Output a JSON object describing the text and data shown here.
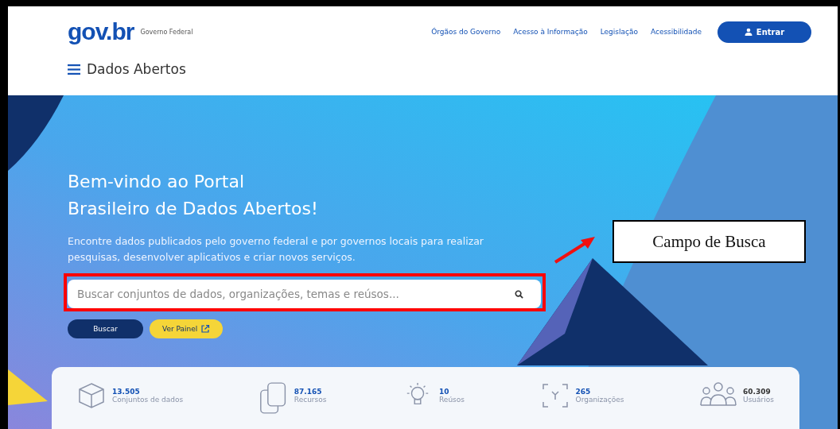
{
  "header": {
    "logo": {
      "wordmark": "gov.br",
      "subtitle": "Governo Federal"
    },
    "nav_links": [
      "Órgãos do Governo",
      "Acesso à Informação",
      "Legislação",
      "Acessibilidade"
    ],
    "login_button": "Entrar",
    "menu_title": "Dados Abertos"
  },
  "hero": {
    "title_lines": [
      "Bem-vindo ao Portal",
      "Brasileiro de Dados Abertos!"
    ],
    "description": "Encontre dados publicados pelo governo federal e por governos locais para realizar pesquisas, desenvolver aplicativos e criar novos serviços.",
    "search": {
      "placeholder": "Buscar conjuntos de dados, organizações, temas e reúsos..."
    },
    "buttons": [
      {
        "label": "Buscar",
        "kind": "primary"
      },
      {
        "label": "Ver Painel",
        "kind": "external"
      }
    ]
  },
  "stats": [
    {
      "value": "13.505",
      "label": "Conjuntos de dados",
      "kind": "cube"
    },
    {
      "value": "87.165",
      "label": "Recursos",
      "kind": "copies"
    },
    {
      "value": "10",
      "label": "Reúsos",
      "kind": "bulb"
    },
    {
      "value": "265",
      "label": "Organizações",
      "kind": "scan"
    },
    {
      "value": "60.309",
      "label": "Usuários",
      "kind": "people"
    }
  ],
  "annotation": {
    "label": "Campo de Busca"
  }
}
